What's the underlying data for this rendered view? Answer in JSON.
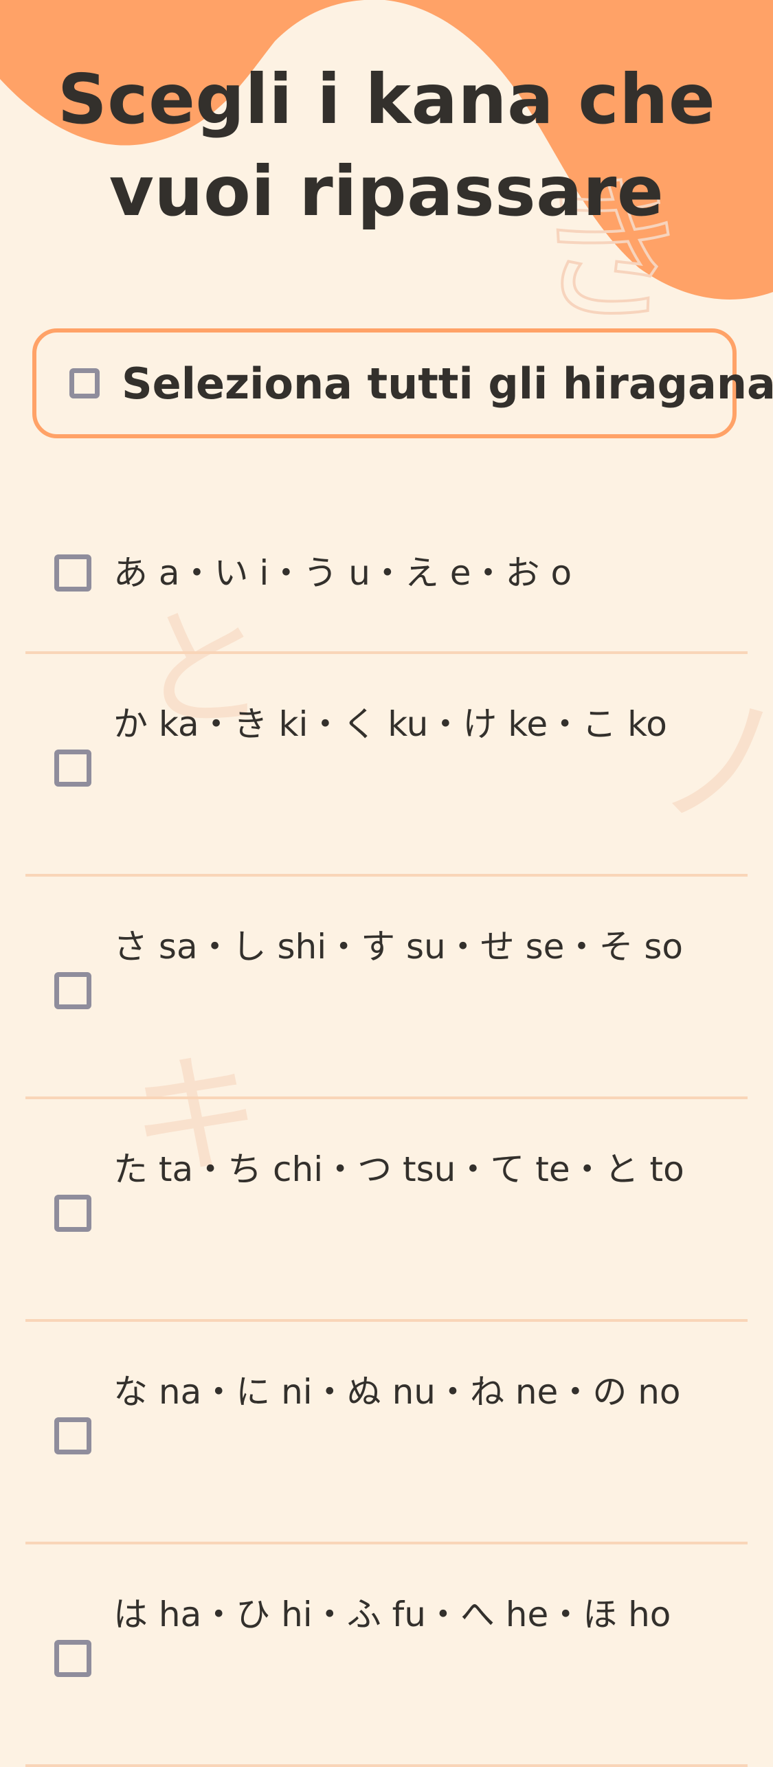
{
  "title": "Scegli i kana che vuoi ripassare",
  "select_all": {
    "label": "Seleziona tutti gli hiragana"
  },
  "rows": [
    {
      "label": "あ a・い i・う u・え e・お o"
    },
    {
      "label": "か ka・き ki・く ku・け ke・こ ko"
    },
    {
      "label": "さ sa・し shi・す su・せ se・そ so"
    },
    {
      "label": "た ta・ち chi・つ tsu・て te・と to"
    },
    {
      "label": "な na・に ni・ぬ nu・ね ne・の no"
    },
    {
      "label": "は ha・ひ hi・ふ fu・へ he・ほ ho"
    }
  ],
  "decor": {
    "kana": [
      "き",
      "と",
      "ノ",
      "キ"
    ]
  },
  "colors": {
    "background": "#fdf2e3",
    "accent": "#ffa267",
    "text": "#33302c",
    "checkbox_border": "#8f8d9c",
    "divider": "#f9d5b8",
    "decor_kana": "#f8dcc6"
  }
}
